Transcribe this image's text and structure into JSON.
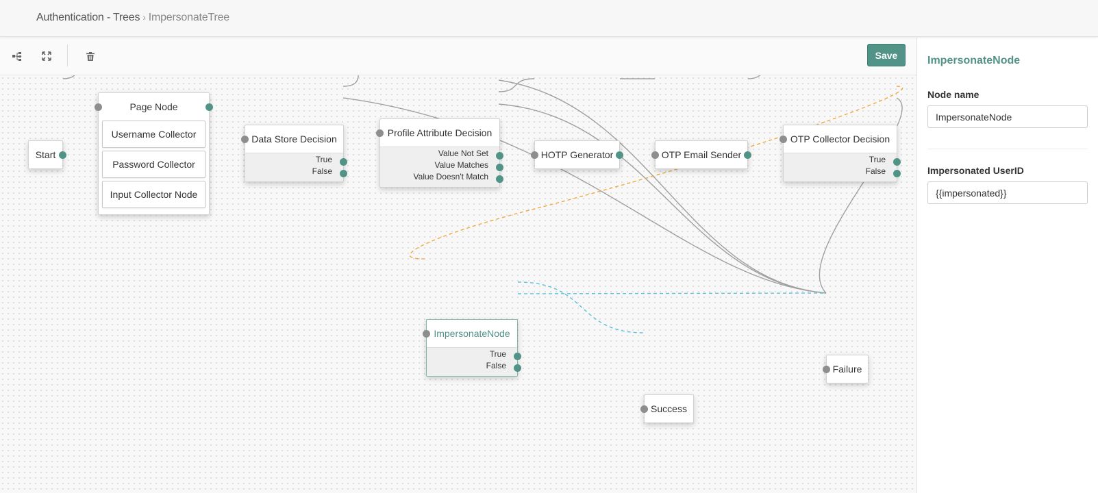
{
  "breadcrumb": {
    "parent": "Authentication - Trees",
    "separator": "›",
    "current": "ImpersonateTree"
  },
  "toolbar": {
    "save_label": "Save",
    "icons": [
      "tree-layout-icon",
      "expand-icon",
      "trash-icon"
    ]
  },
  "nodes": {
    "start": {
      "label": "Start"
    },
    "page": {
      "label": "Page Node",
      "children": [
        "Username Collector",
        "Password Collector",
        "Input Collector Node"
      ]
    },
    "datastore": {
      "label": "Data Store Decision",
      "outcomes": [
        "True",
        "False"
      ]
    },
    "profile": {
      "label": "Profile Attribute Decision",
      "outcomes": [
        "Value Not Set",
        "Value Matches",
        "Value Doesn't Match"
      ]
    },
    "hotp": {
      "label": "HOTP Generator"
    },
    "otpemail": {
      "label": "OTP Email Sender"
    },
    "otpcollector": {
      "label": "OTP Collector Decision",
      "outcomes": [
        "True",
        "False"
      ]
    },
    "impersonate": {
      "label": "ImpersonateNode",
      "outcomes": [
        "True",
        "False"
      ]
    },
    "success": {
      "label": "Success"
    },
    "failure": {
      "label": "Failure"
    }
  },
  "panel": {
    "title": "ImpersonateNode",
    "node_name_label": "Node name",
    "node_name_value": "ImpersonateNode",
    "userid_label": "Impersonated UserID",
    "userid_value": "{{impersonated}}"
  },
  "colors": {
    "accent": "#519387",
    "link": "#a0a0a0",
    "selected_link": "#f0a840",
    "true_false_link": "#5bc0de"
  }
}
